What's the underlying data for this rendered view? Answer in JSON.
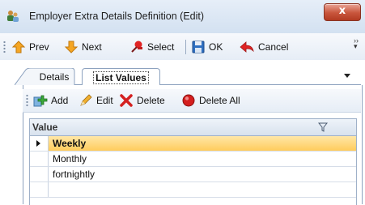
{
  "window": {
    "title": "Employer Extra Details Definition (Edit)",
    "close_label": "x"
  },
  "toolbar": {
    "prev_label": "Prev",
    "next_label": "Next",
    "select_label": "Select",
    "ok_label": "OK",
    "cancel_label": "Cancel",
    "icons": {
      "prev": "up-arrow-icon",
      "next": "down-arrow-icon",
      "select": "select-pin-icon",
      "ok": "save-disk-icon",
      "cancel": "back-arrow-icon"
    }
  },
  "tabs": [
    {
      "label": "Details",
      "active": false
    },
    {
      "label": "List Values",
      "active": true
    }
  ],
  "list_toolbar": {
    "add_label": "Add",
    "edit_label": "Edit",
    "delete_label": "Delete",
    "delete_all_label": "Delete All"
  },
  "grid": {
    "column_header": "Value",
    "rows": [
      {
        "value": "Weekly",
        "selected": true
      },
      {
        "value": "Monthly",
        "selected": false
      },
      {
        "value": "fortnightly",
        "selected": false
      },
      {
        "value": "",
        "selected": false
      }
    ]
  },
  "colors": {
    "selected_row": "#ffcc5c",
    "close_button": "#c8553c",
    "accent_orange": "#f39c12"
  }
}
